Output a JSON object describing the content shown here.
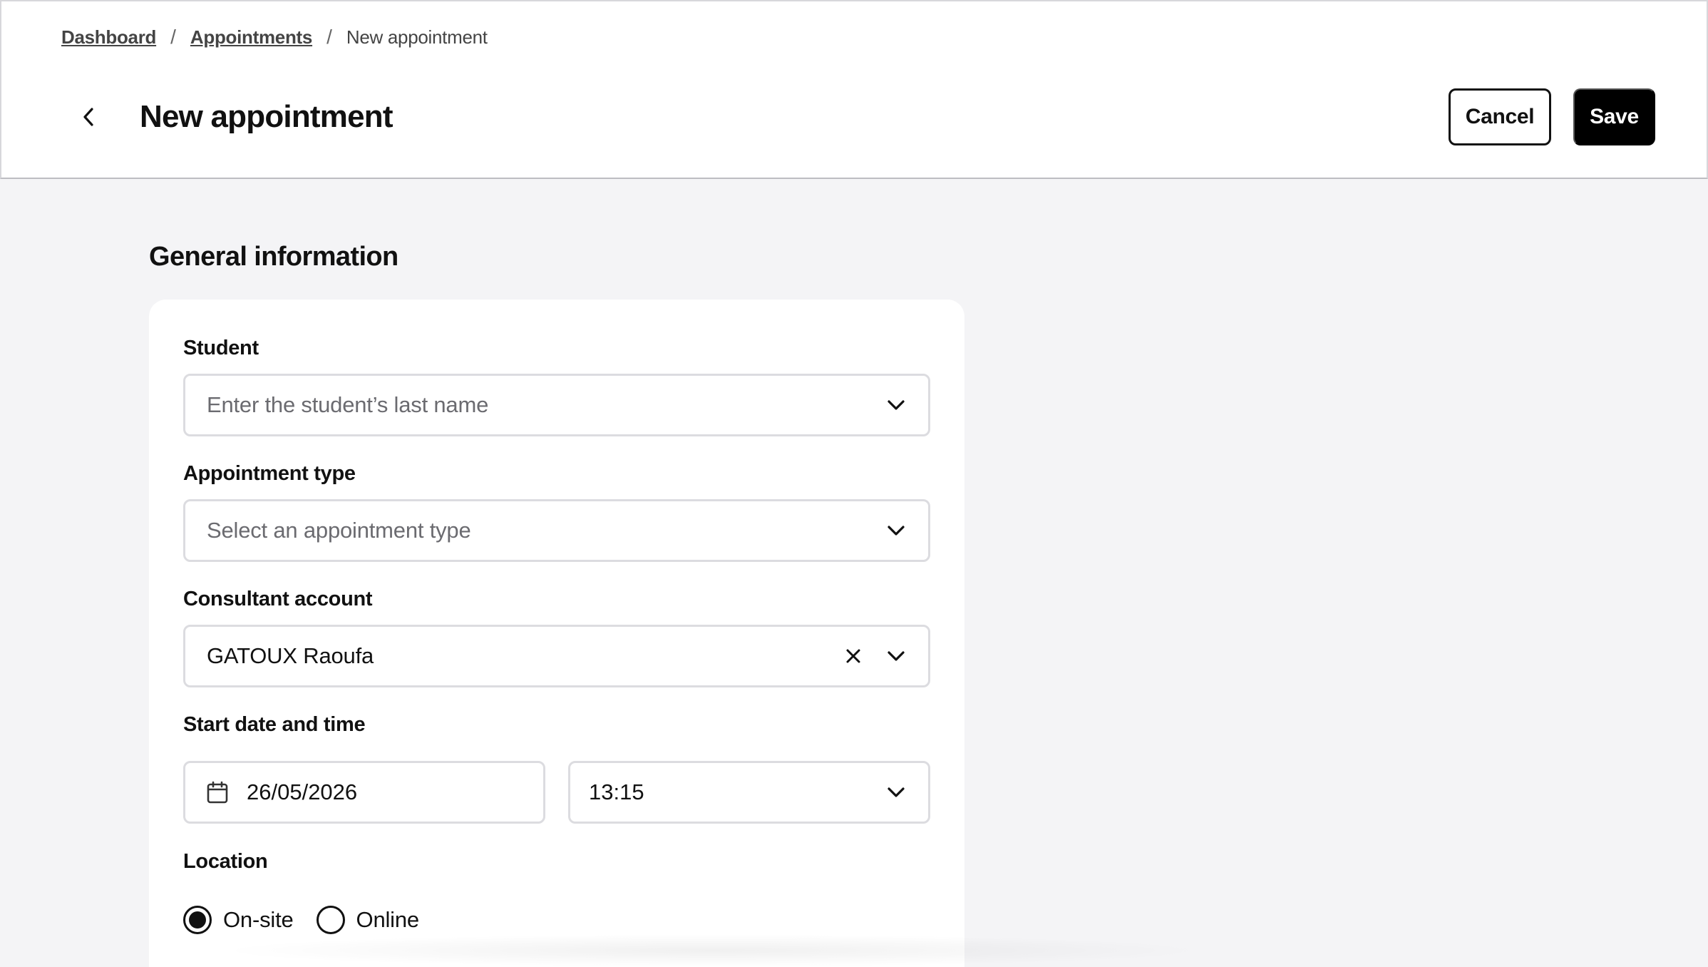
{
  "breadcrumb": {
    "items": [
      {
        "label": "Dashboard"
      },
      {
        "label": "Appointments"
      }
    ],
    "separator": "/",
    "current": "New appointment"
  },
  "header": {
    "title": "New appointment",
    "cancel_label": "Cancel",
    "save_label": "Save",
    "back_icon": "chevron-left-icon"
  },
  "section": {
    "title": "General information"
  },
  "form": {
    "student": {
      "label": "Student",
      "placeholder": "Enter the student’s last name",
      "value": ""
    },
    "appointment_type": {
      "label": "Appointment type",
      "placeholder": "Select an appointment type",
      "value": ""
    },
    "consultant": {
      "label": "Consultant account",
      "value": "GATOUX Raoufa"
    },
    "start": {
      "label": "Start date and time",
      "date": "26/05/2026",
      "time": "13:15"
    },
    "location": {
      "label": "Location",
      "options": [
        {
          "label": "On-site",
          "selected": true
        },
        {
          "label": "Online",
          "selected": false
        }
      ]
    }
  },
  "colors": {
    "primary": "#000000",
    "border": "#dcdce0",
    "background": "#f4f4f6",
    "placeholder": "#6b6b70"
  }
}
